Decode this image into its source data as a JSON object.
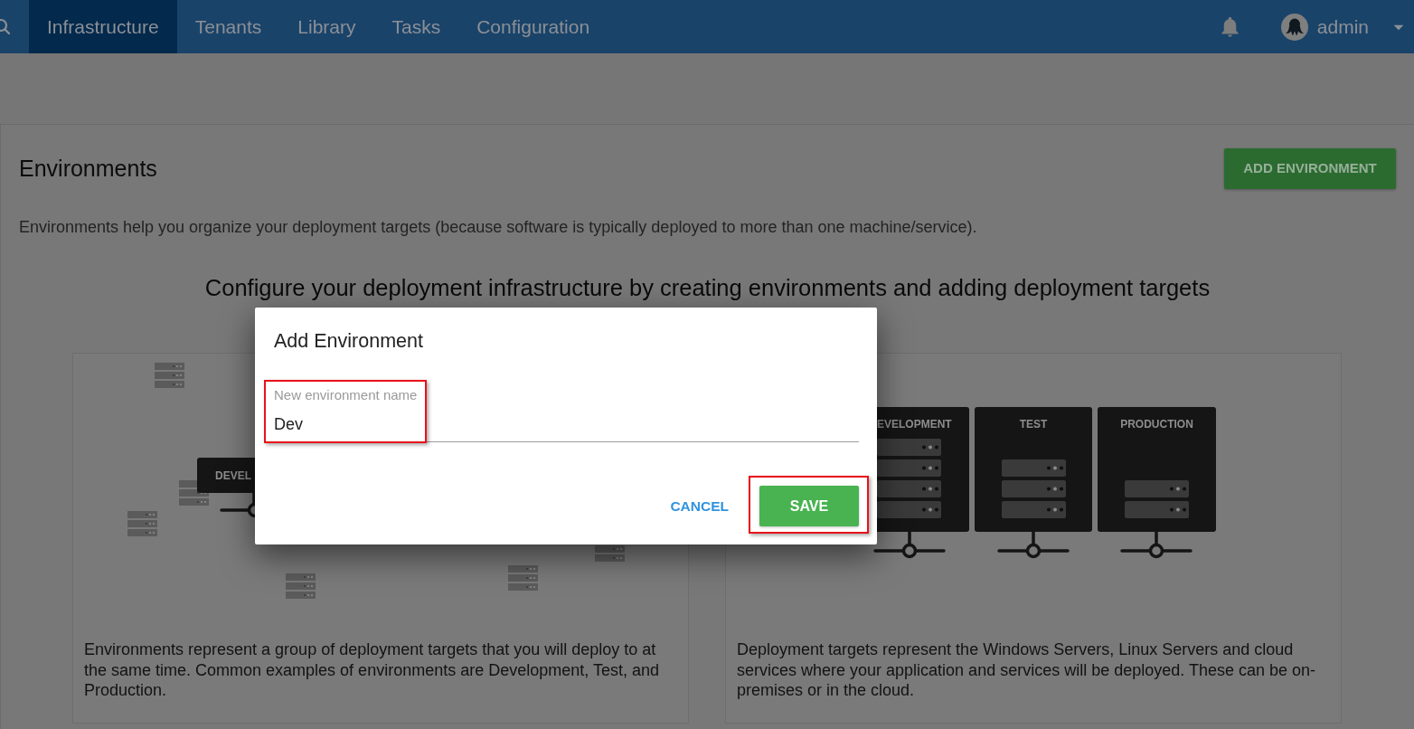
{
  "nav": {
    "tabs": [
      {
        "label": "Infrastructure",
        "selected": true
      },
      {
        "label": "Tenants",
        "selected": false
      },
      {
        "label": "Library",
        "selected": false
      },
      {
        "label": "Tasks",
        "selected": false
      },
      {
        "label": "Configuration",
        "selected": false
      }
    ],
    "user": "admin"
  },
  "page": {
    "title": "Environments",
    "add_button": "ADD ENVIRONMENT",
    "description": "Environments help you organize your deployment targets (because software is typically deployed to more than one machine/service).",
    "heading": "Configure your deployment infrastructure by creating environments and adding deployment targets"
  },
  "cards": [
    {
      "kind": "scattered",
      "illustration_labels": [
        "DEVEL"
      ],
      "text": "Environments represent a group of deployment targets that you will deploy to at the same time. Common examples of environments are Development, Test, and Production."
    },
    {
      "kind": "racks",
      "illustration_labels": [
        "EVELOPMENT",
        "TEST",
        "PRODUCTION"
      ],
      "text": "Deployment targets represent the Windows Servers, Linux Servers and cloud services where your application and services will be deployed. These can be on-premises or in the cloud."
    }
  ],
  "dialog": {
    "title": "Add Environment",
    "field": {
      "label": "New environment name",
      "value": "Dev",
      "highlighted": true
    },
    "buttons": [
      {
        "label": "CANCEL",
        "kind": "text",
        "highlighted": false
      },
      {
        "label": "SAVE",
        "kind": "primary",
        "highlighted": true
      }
    ]
  }
}
